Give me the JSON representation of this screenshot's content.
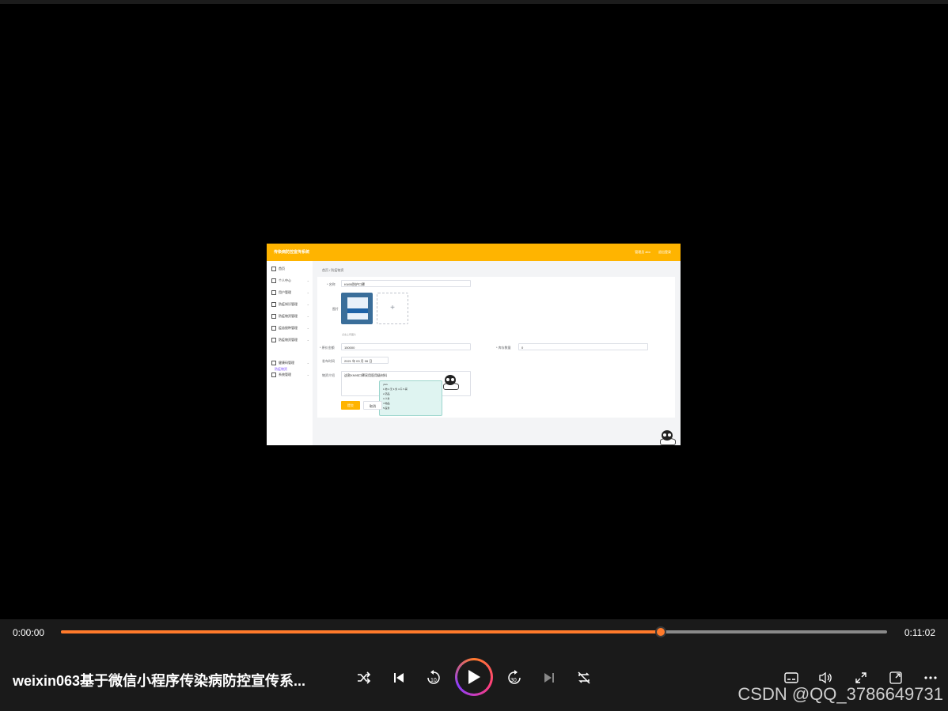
{
  "app": {
    "title": "传染病防控宣传系统",
    "user": "管理员 abo",
    "logout": "退出登录",
    "breadcrumb": "首页 / 防疫物资",
    "sidebar": [
      "首页",
      "个人中心",
      "用户管理",
      "防疫知识管理",
      "防疫物资管理",
      "疫苗接种管理",
      "防疫物资管理",
      "健康码管理",
      "系统管理"
    ],
    "sidebar_sub": "防疫物资",
    "form": {
      "name_label": "* 名称",
      "name_value": "KN95防护口罩",
      "image_label": "图片",
      "upload_hint": "点击上传图片",
      "price_label": "* 原价金额",
      "price_value": "150000",
      "stock_label": "* 库存数量",
      "stock_value": "0",
      "date_label": "发布时间",
      "date_value": "2021 年 03 月 06 日",
      "desc_label": "物资介绍",
      "desc_value": "这款KN95口罩采用医用级材料",
      "save_label": "提交",
      "cancel_label": "取消"
    },
    "ime": {
      "line1": "yiwu",
      "line2": "1.物 2.无 3.务 4.午 5.雾",
      "line3": "2.药品",
      "line4": "3.义务",
      "line5": "4.物品",
      "line6": "5.医务"
    }
  },
  "player": {
    "current_time": "0:00:00",
    "duration": "0:11:02",
    "progress": 0.726,
    "title": "weixin063基于微信小程序传染病防控宣传系...",
    "accent_color": "#ff7a2b",
    "watermark": "CSDN @QQ_3786649731",
    "icons": {
      "shuffle": "shuffle-icon",
      "previous": "previous-icon",
      "rewind": "rewind-10-icon",
      "play": "play-icon",
      "forward": "forward-30-icon",
      "next": "next-icon",
      "repeat": "repeat-off-icon",
      "subtitles": "subtitles-icon",
      "volume": "volume-icon",
      "fullscreen": "fullscreen-icon",
      "miniplayer": "miniplayer-icon",
      "more": "more-icon"
    }
  }
}
